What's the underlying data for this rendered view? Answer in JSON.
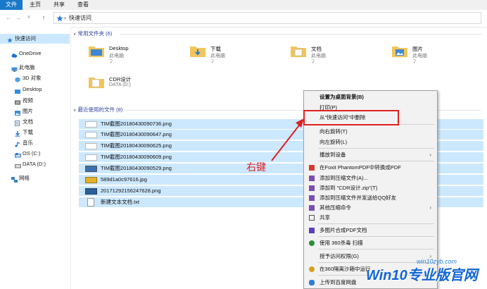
{
  "ribbon": {
    "tabs": [
      "文件",
      "主页",
      "共享",
      "查看"
    ]
  },
  "address": {
    "path": "快速访问"
  },
  "sidebar": {
    "items": [
      {
        "label": "快速访问",
        "icon": "star-icon",
        "color": "#2f7bd9"
      },
      {
        "label": "OneDrive",
        "icon": "cloud-icon",
        "color": "#1c6fd0"
      },
      {
        "label": "此电脑",
        "icon": "pc-icon",
        "color": "#4a8fd8"
      },
      {
        "label": "3D 对象",
        "icon": "cube-icon",
        "color": "#4aa0e0"
      },
      {
        "label": "Desktop",
        "icon": "folder-icon",
        "color": "#2e8fe0"
      },
      {
        "label": "视频",
        "icon": "video-icon",
        "color": "#555"
      },
      {
        "label": "图片",
        "icon": "picture-icon",
        "color": "#3f8ad0"
      },
      {
        "label": "文档",
        "icon": "document-icon",
        "color": "#6a8ab0"
      },
      {
        "label": "下载",
        "icon": "download-icon",
        "color": "#2f7bd9"
      },
      {
        "label": "音乐",
        "icon": "music-icon",
        "color": "#2f7bd9"
      },
      {
        "label": "OS (C:)",
        "icon": "drive-icon",
        "color": "#3a7fc8"
      },
      {
        "label": "DATA (D:)",
        "icon": "drive-icon",
        "color": "#777"
      },
      {
        "label": "网络",
        "icon": "network-icon",
        "color": "#3a7fc8"
      }
    ]
  },
  "frequent": {
    "header": "常用文件夹 (6)",
    "folders": [
      {
        "name": "Desktop",
        "sub": "此电脑"
      },
      {
        "name": "下载",
        "sub": "此电脑"
      },
      {
        "name": "文档",
        "sub": "此电脑"
      },
      {
        "name": "图片",
        "sub": "此电脑"
      },
      {
        "name": "CDR设计",
        "sub": "DATA (D:)"
      }
    ]
  },
  "recent": {
    "header": "最近使用的文件 (8)",
    "files": [
      "TIM截图20180430090736.png",
      "TIM截图20180430090647.png",
      "TIM截图20180430090625.png",
      "TIM截图20180430090609.png",
      "TIM截图20180430090529.png",
      "589d1a0c97616.jpg",
      "20171292156247628.png",
      "新建文本文档.txt"
    ]
  },
  "context_menu": {
    "items": [
      {
        "label": "设置为桌面背景(B)",
        "bold": true
      },
      {
        "label": "打印(P)"
      },
      {
        "label": "从\"快速访问\"中删除"
      },
      {
        "sep": true
      },
      {
        "label": "向右旋转(T)"
      },
      {
        "label": "向左旋转(L)"
      },
      {
        "sep": true
      },
      {
        "label": "播放到设备",
        "arrow": true
      },
      {
        "sep": true
      },
      {
        "label": "在Foxit PhantomPDF中转换成PDF",
        "icon": "pdf-icon"
      },
      {
        "label": "添加到压缩文件(A)...",
        "icon": "archive-icon"
      },
      {
        "label": "添加到 \"CDR设计.zip\"(T)",
        "icon": "archive-icon"
      },
      {
        "label": "添加到压缩文件并发送给QQ好友",
        "icon": "archive-icon"
      },
      {
        "label": "其他压缩命令",
        "icon": "archive-icon",
        "arrow": true
      },
      {
        "label": "共享",
        "icon": "share-icon"
      },
      {
        "sep": true
      },
      {
        "label": "多图片合成PDF文档",
        "icon": "pdf-merge-icon"
      },
      {
        "sep": true
      },
      {
        "label": "使用 360杀毒 扫描",
        "icon": "antivirus-icon"
      },
      {
        "sep": true
      },
      {
        "label": "授予访问权限(G)",
        "arrow": true
      },
      {
        "sep": true
      },
      {
        "label": "在360隔离沙箱中运行",
        "icon": "sandbox-icon"
      },
      {
        "sep": true
      },
      {
        "label": "上传到百度网盘",
        "icon": "cloud-upload-icon"
      }
    ]
  },
  "annotation": {
    "text": "右键"
  },
  "watermark": {
    "text": "Win10专业版官网",
    "sub": "win10zyb.com"
  }
}
